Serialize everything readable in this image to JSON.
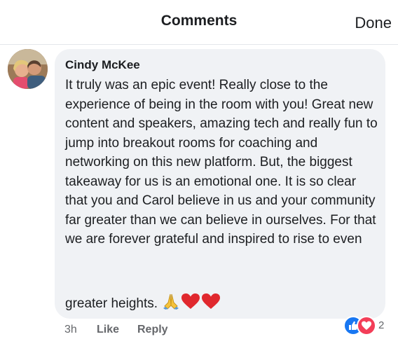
{
  "header": {
    "title": "Comments",
    "done_label": "Done"
  },
  "comment": {
    "author": "Cindy McKee",
    "text": "It truly was an epic event! Really close to the experience of being in the room with you! Great new content and speakers, amazing tech and really fun to jump into breakout rooms for coaching and networking on this new platform. But, the biggest takeaway for us is an emotional one. It is so clear that you and Carol believe in us and your community far greater than we can believe in ourselves. For that we are forever grateful and inspired to rise to even",
    "last_line": "greater heights.",
    "emojis": [
      "folded-hands",
      "red-heart",
      "red-heart"
    ],
    "time": "3h",
    "like_label": "Like",
    "reply_label": "Reply",
    "reactions": {
      "types": [
        "like",
        "love"
      ],
      "count": "2"
    }
  },
  "colors": {
    "bubble": "#f0f2f5",
    "meta_text": "#65676b",
    "like_blue": "#1877f2",
    "love_red": "#f33e58"
  }
}
